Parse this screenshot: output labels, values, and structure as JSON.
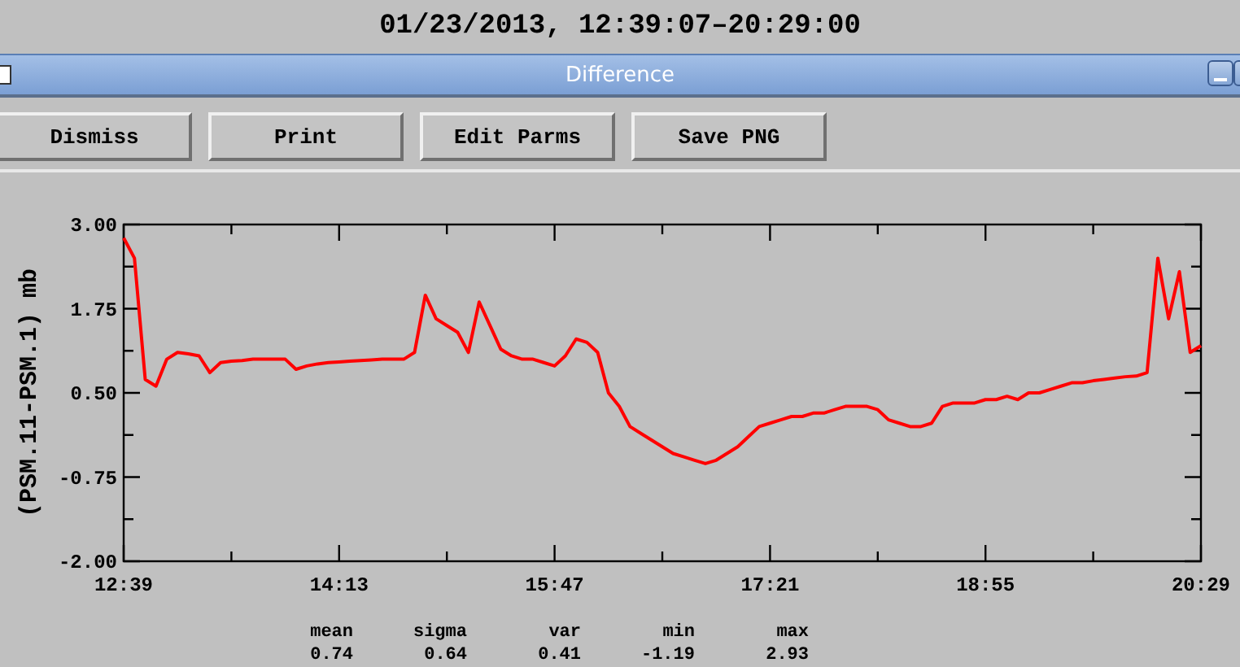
{
  "heading": "01/23/2013, 12:39:07–20:29:00",
  "window": {
    "title": "Difference"
  },
  "buttons": [
    "Dismiss",
    "Print",
    "Edit Parms",
    "Save PNG"
  ],
  "chart_data": {
    "type": "line",
    "ylabel": "(PSM.11-PSM.1) mb",
    "ylim": [
      -2,
      3
    ],
    "yticks": [
      {
        "value": -2,
        "label": "-2.00"
      },
      {
        "value": -0.75,
        "label": "-0.75"
      },
      {
        "value": 0.5,
        "label": "0.50"
      },
      {
        "value": 1.75,
        "label": "1.75"
      },
      {
        "value": 3,
        "label": "3.00"
      }
    ],
    "categories": [
      "12:39",
      null,
      null,
      null,
      null,
      null,
      null,
      null,
      null,
      null,
      null,
      null,
      null,
      null,
      null,
      null,
      null,
      null,
      null,
      null,
      "14:13",
      null,
      null,
      null,
      null,
      null,
      null,
      null,
      null,
      null,
      null,
      null,
      null,
      null,
      null,
      null,
      null,
      null,
      null,
      null,
      "15:47",
      null,
      null,
      null,
      null,
      null,
      null,
      null,
      null,
      null,
      null,
      null,
      null,
      null,
      null,
      null,
      null,
      null,
      null,
      null,
      "17:21",
      null,
      null,
      null,
      null,
      null,
      null,
      null,
      null,
      null,
      null,
      null,
      null,
      null,
      null,
      null,
      null,
      null,
      null,
      null,
      "18:55",
      null,
      null,
      null,
      null,
      null,
      null,
      null,
      null,
      null,
      null,
      null,
      null,
      null,
      null,
      null,
      null,
      null,
      null,
      null,
      "20:29"
    ],
    "series": [
      {
        "color": "#ff0000",
        "values": [
          2.8,
          2.5,
          0.7,
          0.6,
          1.0,
          1.1,
          1.08,
          1.05,
          0.8,
          0.95,
          0.97,
          0.98,
          1.0,
          1.0,
          1.0,
          1.0,
          0.85,
          0.9,
          0.93,
          0.95,
          0.96,
          0.97,
          0.98,
          0.99,
          1.0,
          1.0,
          1.0,
          1.1,
          1.95,
          1.6,
          1.5,
          1.4,
          1.1,
          1.85,
          1.5,
          1.15,
          1.05,
          1.0,
          1.0,
          0.95,
          0.9,
          1.05,
          1.3,
          1.25,
          1.1,
          0.5,
          0.3,
          0.0,
          -0.1,
          -0.2,
          -0.3,
          -0.4,
          -0.45,
          -0.5,
          -0.55,
          -0.5,
          -0.4,
          -0.3,
          -0.15,
          0.0,
          0.05,
          0.1,
          0.15,
          0.15,
          0.2,
          0.2,
          0.25,
          0.3,
          0.3,
          0.3,
          0.25,
          0.1,
          0.05,
          0.0,
          0.0,
          0.05,
          0.3,
          0.35,
          0.35,
          0.35,
          0.4,
          0.4,
          0.45,
          0.4,
          0.5,
          0.5,
          0.55,
          0.6,
          0.65,
          0.65,
          0.68,
          0.7,
          0.72,
          0.74,
          0.75,
          0.8,
          2.5,
          1.6,
          2.3,
          1.1,
          1.2
        ]
      }
    ]
  },
  "stats": [
    {
      "label": "mean",
      "value": "0.74"
    },
    {
      "label": "sigma",
      "value": "0.64"
    },
    {
      "label": "var",
      "value": "0.41"
    },
    {
      "label": "min",
      "value": "-1.19"
    },
    {
      "label": "max",
      "value": "2.93"
    }
  ]
}
